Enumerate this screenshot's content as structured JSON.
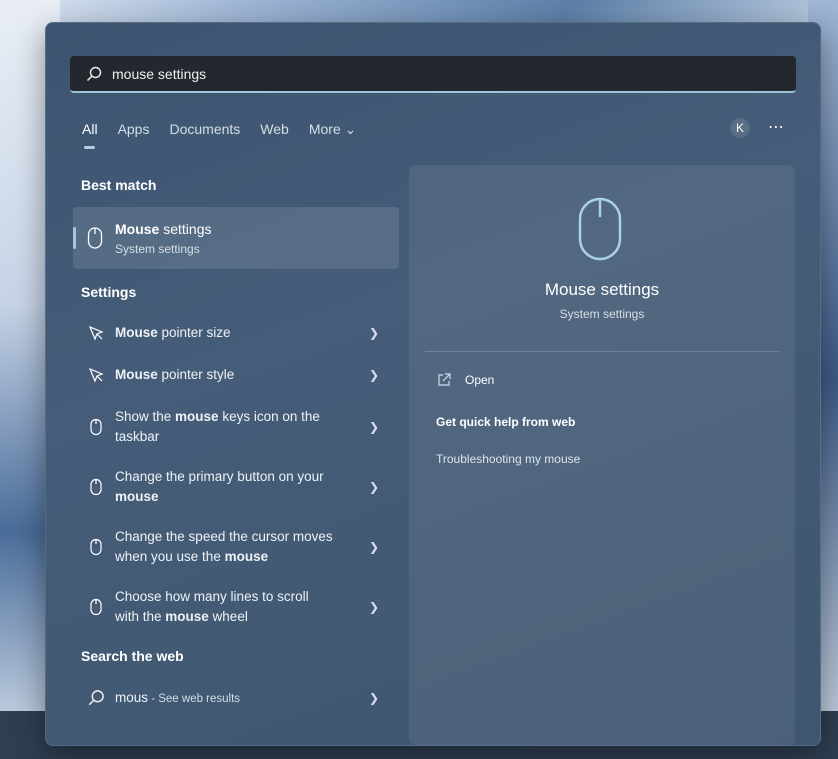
{
  "search": {
    "value": "mouse settings"
  },
  "tabs": [
    {
      "label": "All",
      "active": true
    },
    {
      "label": "Apps"
    },
    {
      "label": "Documents"
    },
    {
      "label": "Web"
    },
    {
      "label": "More ⌄"
    }
  ],
  "user_initial": "K",
  "more_icon": "⋯",
  "sections": {
    "best_match": "Best match",
    "settings": "Settings",
    "search_web": "Search the web"
  },
  "best_match": {
    "title_bold": "Mouse",
    "title_rest": " settings",
    "subtitle": "System settings"
  },
  "settings": [
    {
      "icon": "pointer-icon",
      "pre": "",
      "bold": "Mouse",
      "post": " pointer size"
    },
    {
      "icon": "pointer-icon",
      "pre": "",
      "bold": "Mouse",
      "post": " pointer style"
    },
    {
      "icon": "mouse-icon",
      "pre": "Show the ",
      "bold": "mouse",
      "post": " keys icon on the taskbar"
    },
    {
      "icon": "mouse-icon",
      "pre": "Change the primary button on your ",
      "bold": "mouse",
      "post": ""
    },
    {
      "icon": "mouse-icon",
      "pre": "Change the speed the cursor moves when you use the ",
      "bold": "mouse",
      "post": ""
    },
    {
      "icon": "mouse-icon",
      "pre": "Choose how many lines to scroll with the ",
      "bold": "mouse",
      "post": " wheel"
    }
  ],
  "web": {
    "query": "mous",
    "suffix": " - See web results"
  },
  "preview": {
    "title": "Mouse settings",
    "subtitle": "System settings",
    "open": "Open",
    "help": "Get quick help from web",
    "trouble": "Troubleshooting my mouse"
  },
  "colors": {
    "accent": "#9fc3d8"
  }
}
